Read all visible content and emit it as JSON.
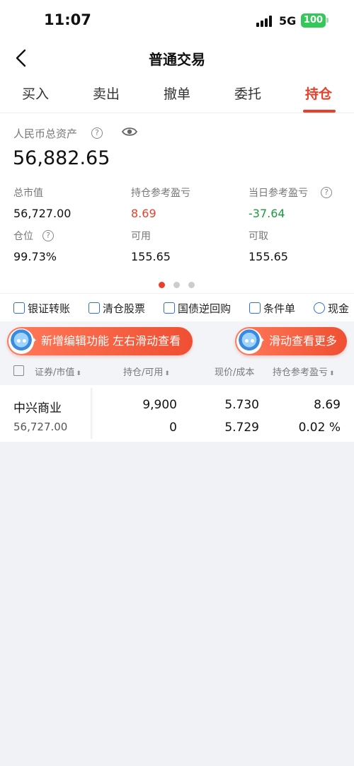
{
  "status_bar": {
    "time": "11:07",
    "network": "5G",
    "battery": "100"
  },
  "nav": {
    "title": "普通交易"
  },
  "tabs": [
    {
      "label": "买入"
    },
    {
      "label": "卖出"
    },
    {
      "label": "撤单"
    },
    {
      "label": "委托"
    },
    {
      "label": "持仓"
    }
  ],
  "active_tab": "持仓",
  "assets": {
    "title": "人民币总资产",
    "total": "56,882.65",
    "metrics": [
      {
        "label": "总市值",
        "value": "56,727.00"
      },
      {
        "label": "持仓参考盈亏",
        "value": "8.69"
      },
      {
        "label": "当日参考盈亏",
        "value": "-37.64"
      },
      {
        "label": "仓位",
        "value": "99.73%"
      },
      {
        "label": "可用",
        "value": "155.65"
      },
      {
        "label": "可取",
        "value": "155.65"
      }
    ]
  },
  "quick_actions": [
    {
      "label": "银证转账",
      "icon": "transfer-icon"
    },
    {
      "label": "清仓股票",
      "icon": "chart-icon"
    },
    {
      "label": "国债逆回购",
      "icon": "repo-icon"
    },
    {
      "label": "条件单",
      "icon": "document-icon"
    },
    {
      "label": "现金",
      "icon": "cash-icon"
    }
  ],
  "banners": {
    "left": "新增编辑功能 左右滑动查看",
    "right": "滑动查看更多"
  },
  "columns": {
    "security": "证券/市值",
    "position": "持仓/可用",
    "price": "现价/成本",
    "pnl": "持仓参考盈亏",
    "sort_glyph": "⬍"
  },
  "holdings": [
    {
      "name": "中兴商业",
      "market_value": "56,727.00",
      "position": "9,900",
      "available": "0",
      "price": "5.730",
      "cost": "5.729",
      "pnl": "8.69",
      "pnl_pct": "0.02 %"
    }
  ],
  "colors": {
    "accent": "#e8402b",
    "gain": "#e8402b",
    "loss": "#1a9b3e",
    "link": "#2f6fd6"
  }
}
